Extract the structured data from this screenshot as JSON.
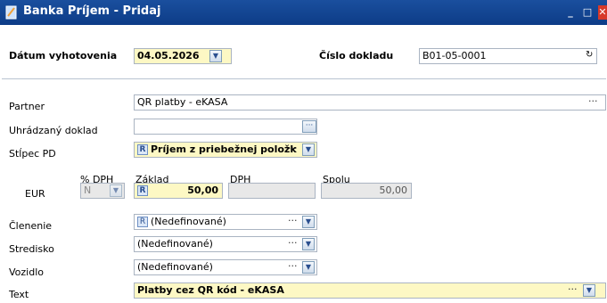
{
  "window": {
    "title": "Banka Príjem - Pridaj",
    "min_symbol": "_",
    "max_symbol": "□",
    "close_symbol": "✕"
  },
  "header": {
    "date_label": "Dátum vyhotovenia",
    "date_value": "04.05.2026",
    "doc_number_label": "Číslo dokladu",
    "doc_number_value": "B01-05-0001"
  },
  "form": {
    "partner_label": "Partner",
    "partner_value": "QR platby - eKASA",
    "paid_doc_label": "Uhrádzaný doklad",
    "paid_doc_value": "",
    "column_label": "Stĺpec PD",
    "column_value": "Príjem z priebežnej položk",
    "currency_label": "EUR",
    "vat_pct_header": "% DPH",
    "vat_pct_value": "N",
    "base_header": "Základ",
    "base_value": "50,00",
    "vat_header": "DPH",
    "vat_value": "",
    "total_header": "Spolu",
    "total_value": "50,00",
    "division_label": "Členenie",
    "division_value": "(Nedefinované)",
    "center_label": "Stredisko",
    "center_value": "(Nedefinované)",
    "vehicle_label": "Vozidlo",
    "vehicle_value": "(Nedefinované)",
    "text_label": "Text",
    "text_value": "Platby cez QR kód - eKASA"
  },
  "badge_letter": "R",
  "colors": {
    "titlebar": "#0d3c87",
    "highlight_field": "#fdf8c4",
    "close_button": "#d73a2a"
  }
}
